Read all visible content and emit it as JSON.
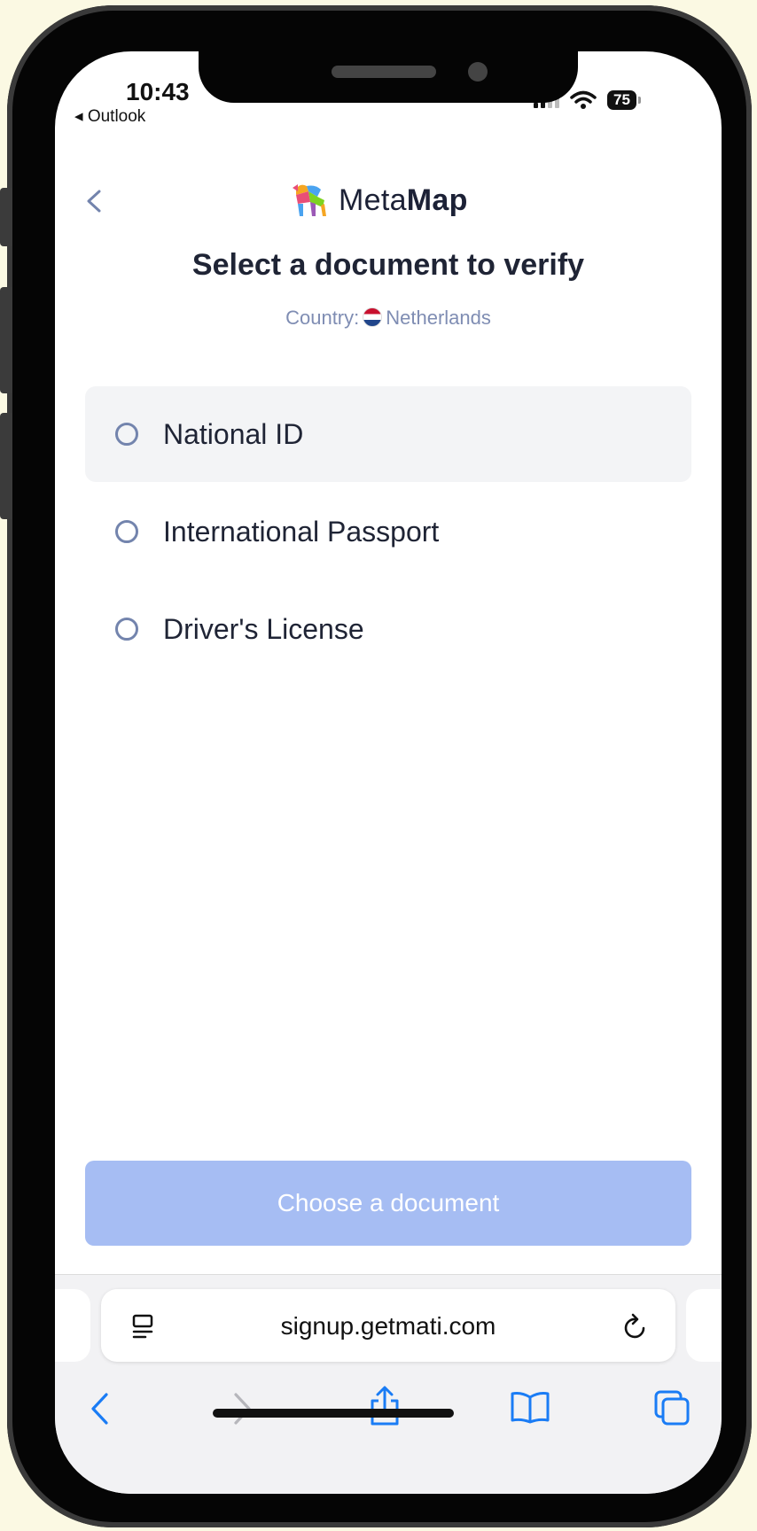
{
  "status_bar": {
    "time": "10:43",
    "back_app": "◂ Outlook",
    "battery": "75"
  },
  "header": {
    "brand_light": "Meta",
    "brand_bold": "Map",
    "title": "Select a document to verify",
    "country_label": "Country:",
    "country_name": "Netherlands"
  },
  "options": [
    {
      "label": "National ID",
      "selected": false
    },
    {
      "label": "International Passport",
      "selected": false
    },
    {
      "label": "Driver's License",
      "selected": false
    }
  ],
  "primary_button": {
    "label": "Choose a document"
  },
  "browser": {
    "url": "signup.getmati.com"
  },
  "colors": {
    "accent": "#a6bdf3",
    "radio": "#7384ad",
    "title": "#1f2435",
    "muted": "#7f8db3",
    "system_blue": "#1a7cf5"
  },
  "icons": [
    "back-chevron-icon",
    "metamap-logo-icon",
    "netherlands-flag-icon",
    "reader-mode-icon",
    "reload-icon",
    "safari-back-icon",
    "safari-forward-icon",
    "share-icon",
    "bookmarks-icon",
    "tabs-icon",
    "wifi-icon",
    "signal-icon"
  ]
}
